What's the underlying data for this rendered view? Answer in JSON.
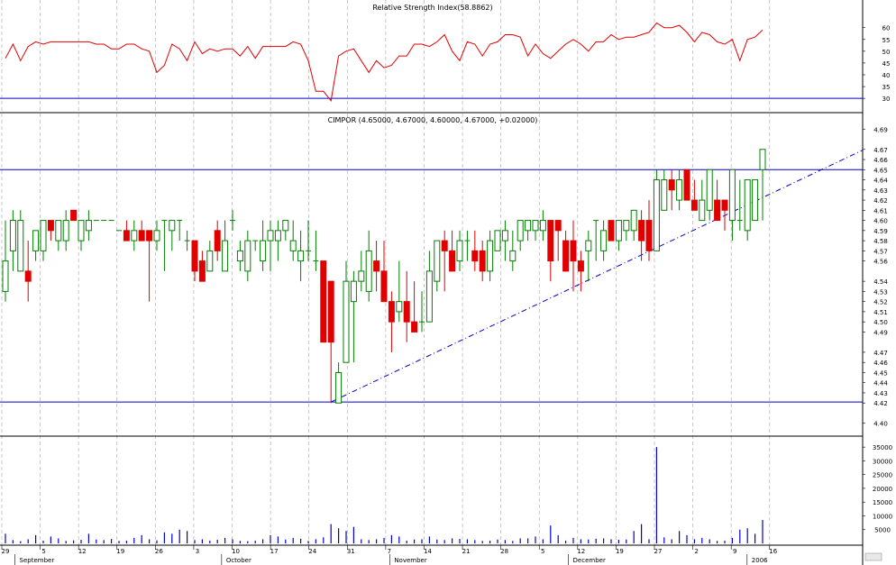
{
  "chart_data": [
    {
      "type": "line",
      "title": "Relative Strength Index(58.8862)",
      "ylim": [
        27,
        66
      ],
      "yticks": [
        30,
        35,
        40,
        45,
        50,
        55,
        60
      ],
      "reference_level": 30,
      "series": [
        {
          "name": "RSI",
          "color": "#e00000",
          "values": [
            47,
            53,
            46,
            52,
            54,
            53,
            54,
            54,
            54,
            54,
            54,
            54,
            53,
            53,
            51,
            51,
            53,
            53,
            51,
            50,
            41,
            44,
            53,
            51,
            46,
            54,
            49,
            51,
            50,
            51,
            51,
            48,
            52,
            47,
            52,
            52,
            52,
            52,
            54,
            53,
            46,
            33,
            33,
            29,
            48,
            50,
            51,
            46,
            41,
            46,
            43,
            44,
            48,
            48,
            53,
            53,
            52,
            54,
            57,
            50,
            46,
            54,
            53,
            48,
            53,
            54,
            57,
            57,
            56,
            48,
            53,
            49,
            47,
            50,
            53,
            55,
            53,
            50,
            54,
            54,
            57,
            55,
            56,
            56,
            57,
            58,
            62,
            60,
            60,
            61,
            58,
            54,
            58,
            57,
            54,
            53,
            55,
            46,
            55,
            56,
            59
          ]
        }
      ]
    },
    {
      "type": "candlestick",
      "title": "CIMPOR (4.65000, 4.67000, 4.60000, 4.67000, +0.02000)",
      "ylim": [
        4.39,
        4.7
      ],
      "yticks": [
        "4.40",
        "4.42",
        "4.43",
        "4.44",
        "4.45",
        "4.46",
        "4.47",
        "4.49",
        "4.50",
        "4.51",
        "4.52",
        "4.53",
        "4.54",
        "4.56",
        "4.57",
        "4.58",
        "4.59",
        "4.60",
        "4.61",
        "4.62",
        "4.63",
        "4.64",
        "4.65",
        "4.66",
        "4.67",
        "4.69"
      ],
      "horizontal_levels": [
        4.65,
        4.421
      ],
      "trendline": {
        "from": [
          43,
          4.421
        ],
        "to": [
          114,
          4.672
        ],
        "style": "dash-dot",
        "color": "#0000c8"
      },
      "colors": {
        "up": "#008000",
        "down": "#e00000",
        "doji": "#008000"
      },
      "candles": [
        {
          "o": 4.53,
          "h": 4.6,
          "l": 4.52,
          "c": 4.56
        },
        {
          "o": 4.57,
          "h": 4.61,
          "l": 4.55,
          "c": 4.6
        },
        {
          "o": 4.55,
          "h": 4.61,
          "l": 4.55,
          "c": 4.6
        },
        {
          "o": 4.55,
          "h": 4.58,
          "l": 4.52,
          "c": 4.54
        },
        {
          "o": 4.57,
          "h": 4.59,
          "l": 4.56,
          "c": 4.59
        },
        {
          "o": 4.57,
          "h": 4.6,
          "l": 4.56,
          "c": 4.6
        },
        {
          "o": 4.6,
          "h": 4.6,
          "l": 4.58,
          "c": 4.59
        },
        {
          "o": 4.58,
          "h": 4.6,
          "l": 4.57,
          "c": 4.6
        },
        {
          "o": 4.58,
          "h": 4.61,
          "l": 4.57,
          "c": 4.6
        },
        {
          "o": 4.61,
          "h": 4.61,
          "l": 4.6,
          "c": 4.6
        },
        {
          "o": 4.58,
          "h": 4.6,
          "l": 4.57,
          "c": 4.6
        },
        {
          "o": 4.59,
          "h": 4.61,
          "l": 4.58,
          "c": 4.6
        },
        {
          "o": 4.6,
          "h": 4.6,
          "l": 4.6,
          "c": 4.6
        },
        {
          "o": 4.6,
          "h": 4.6,
          "l": 4.6,
          "c": 4.6
        },
        {
          "o": 4.6,
          "h": 4.6,
          "l": 4.6,
          "c": 4.6
        },
        {
          "o": 4.59,
          "h": 4.59,
          "l": 4.59,
          "c": 4.59
        },
        {
          "o": 4.59,
          "h": 4.6,
          "l": 4.58,
          "c": 4.58
        },
        {
          "o": 4.58,
          "h": 4.6,
          "l": 4.57,
          "c": 4.59
        },
        {
          "o": 4.59,
          "h": 4.6,
          "l": 4.58,
          "c": 4.58
        },
        {
          "o": 4.59,
          "h": 4.59,
          "l": 4.52,
          "c": 4.58
        },
        {
          "o": 4.58,
          "h": 4.6,
          "l": 4.57,
          "c": 4.59
        },
        {
          "o": 4.6,
          "h": 4.6,
          "l": 4.55,
          "c": 4.6
        },
        {
          "o": 4.59,
          "h": 4.6,
          "l": 4.57,
          "c": 4.6
        },
        {
          "o": 4.6,
          "h": 4.6,
          "l": 4.58,
          "c": 4.6
        },
        {
          "o": 4.58,
          "h": 4.59,
          "l": 4.57,
          "c": 4.58
        },
        {
          "o": 4.58,
          "h": 4.58,
          "l": 4.54,
          "c": 4.55
        },
        {
          "o": 4.56,
          "h": 4.57,
          "l": 4.54,
          "c": 4.54
        },
        {
          "o": 4.55,
          "h": 4.58,
          "l": 4.55,
          "c": 4.57
        },
        {
          "o": 4.59,
          "h": 4.6,
          "l": 4.56,
          "c": 4.57
        },
        {
          "o": 4.55,
          "h": 4.6,
          "l": 4.55,
          "c": 4.58
        },
        {
          "o": 4.6,
          "h": 4.61,
          "l": 4.59,
          "c": 4.6
        },
        {
          "o": 4.56,
          "h": 4.58,
          "l": 4.55,
          "c": 4.57
        },
        {
          "o": 4.55,
          "h": 4.59,
          "l": 4.54,
          "c": 4.58
        },
        {
          "o": 4.58,
          "h": 4.58,
          "l": 4.57,
          "c": 4.58
        },
        {
          "o": 4.56,
          "h": 4.6,
          "l": 4.55,
          "c": 4.58
        },
        {
          "o": 4.58,
          "h": 4.6,
          "l": 4.55,
          "c": 4.59
        },
        {
          "o": 4.58,
          "h": 4.6,
          "l": 4.56,
          "c": 4.59
        },
        {
          "o": 4.59,
          "h": 4.6,
          "l": 4.58,
          "c": 4.6
        },
        {
          "o": 4.57,
          "h": 4.6,
          "l": 4.56,
          "c": 4.58
        },
        {
          "o": 4.56,
          "h": 4.59,
          "l": 4.54,
          "c": 4.57
        },
        {
          "o": 4.57,
          "h": 4.6,
          "l": 4.56,
          "c": 4.57
        },
        {
          "o": 4.56,
          "h": 4.59,
          "l": 4.55,
          "c": 4.56
        },
        {
          "o": 4.56,
          "h": 4.56,
          "l": 4.48,
          "c": 4.48
        },
        {
          "o": 4.54,
          "h": 4.54,
          "l": 4.42,
          "c": 4.48
        },
        {
          "o": 4.42,
          "h": 4.46,
          "l": 4.42,
          "c": 4.45
        },
        {
          "o": 4.46,
          "h": 4.56,
          "l": 4.46,
          "c": 4.54
        },
        {
          "o": 4.52,
          "h": 4.55,
          "l": 4.46,
          "c": 4.54
        },
        {
          "o": 4.54,
          "h": 4.57,
          "l": 4.53,
          "c": 4.55
        },
        {
          "o": 4.53,
          "h": 4.59,
          "l": 4.52,
          "c": 4.57
        },
        {
          "o": 4.56,
          "h": 4.58,
          "l": 4.53,
          "c": 4.55
        },
        {
          "o": 4.55,
          "h": 4.58,
          "l": 4.52,
          "c": 4.52
        },
        {
          "o": 4.52,
          "h": 4.53,
          "l": 4.47,
          "c": 4.5
        },
        {
          "o": 4.51,
          "h": 4.56,
          "l": 4.5,
          "c": 4.52
        },
        {
          "o": 4.52,
          "h": 4.55,
          "l": 4.48,
          "c": 4.5
        },
        {
          "o": 4.5,
          "h": 4.54,
          "l": 4.49,
          "c": 4.49
        },
        {
          "o": 4.5,
          "h": 4.53,
          "l": 4.49,
          "c": 4.5
        },
        {
          "o": 4.5,
          "h": 4.57,
          "l": 4.5,
          "c": 4.55
        },
        {
          "o": 4.54,
          "h": 4.58,
          "l": 4.53,
          "c": 4.58
        },
        {
          "o": 4.58,
          "h": 4.59,
          "l": 4.53,
          "c": 4.57
        },
        {
          "o": 4.57,
          "h": 4.59,
          "l": 4.55,
          "c": 4.55
        },
        {
          "o": 4.56,
          "h": 4.59,
          "l": 4.55,
          "c": 4.58
        },
        {
          "o": 4.58,
          "h": 4.59,
          "l": 4.56,
          "c": 4.58
        },
        {
          "o": 4.57,
          "h": 4.59,
          "l": 4.55,
          "c": 4.56
        },
        {
          "o": 4.57,
          "h": 4.58,
          "l": 4.54,
          "c": 4.55
        },
        {
          "o": 4.55,
          "h": 4.59,
          "l": 4.54,
          "c": 4.58
        },
        {
          "o": 4.57,
          "h": 4.59,
          "l": 4.57,
          "c": 4.59
        },
        {
          "o": 4.58,
          "h": 4.6,
          "l": 4.56,
          "c": 4.59
        },
        {
          "o": 4.56,
          "h": 4.59,
          "l": 4.55,
          "c": 4.57
        },
        {
          "o": 4.58,
          "h": 4.6,
          "l": 4.57,
          "c": 4.6
        },
        {
          "o": 4.59,
          "h": 4.6,
          "l": 4.58,
          "c": 4.6
        },
        {
          "o": 4.59,
          "h": 4.6,
          "l": 4.58,
          "c": 4.6
        },
        {
          "o": 4.59,
          "h": 4.61,
          "l": 4.58,
          "c": 4.6
        },
        {
          "o": 4.6,
          "h": 4.6,
          "l": 4.54,
          "c": 4.56
        },
        {
          "o": 4.6,
          "h": 4.6,
          "l": 4.56,
          "c": 4.59
        },
        {
          "o": 4.58,
          "h": 4.59,
          "l": 4.55,
          "c": 4.55
        },
        {
          "o": 4.58,
          "h": 4.6,
          "l": 4.53,
          "c": 4.56
        },
        {
          "o": 4.56,
          "h": 4.57,
          "l": 4.53,
          "c": 4.55
        },
        {
          "o": 4.57,
          "h": 4.59,
          "l": 4.54,
          "c": 4.58
        },
        {
          "o": 4.6,
          "h": 4.6,
          "l": 4.56,
          "c": 4.6
        },
        {
          "o": 4.57,
          "h": 4.6,
          "l": 4.56,
          "c": 4.59
        },
        {
          "o": 4.6,
          "h": 4.6,
          "l": 4.58,
          "c": 4.58
        },
        {
          "o": 4.58,
          "h": 4.6,
          "l": 4.57,
          "c": 4.6
        },
        {
          "o": 4.59,
          "h": 4.6,
          "l": 4.58,
          "c": 4.6
        },
        {
          "o": 4.59,
          "h": 4.61,
          "l": 4.58,
          "c": 4.61
        },
        {
          "o": 4.6,
          "h": 4.61,
          "l": 4.56,
          "c": 4.58
        },
        {
          "o": 4.6,
          "h": 4.62,
          "l": 4.56,
          "c": 4.57
        },
        {
          "o": 4.57,
          "h": 4.65,
          "l": 4.57,
          "c": 4.64
        },
        {
          "o": 4.61,
          "h": 4.65,
          "l": 4.61,
          "c": 4.64
        },
        {
          "o": 4.64,
          "h": 4.65,
          "l": 4.61,
          "c": 4.63
        },
        {
          "o": 4.62,
          "h": 4.65,
          "l": 4.61,
          "c": 4.64
        },
        {
          "o": 4.65,
          "h": 4.65,
          "l": 4.62,
          "c": 4.62
        },
        {
          "o": 4.62,
          "h": 4.64,
          "l": 4.61,
          "c": 4.61
        },
        {
          "o": 4.6,
          "h": 4.64,
          "l": 4.6,
          "c": 4.62
        },
        {
          "o": 4.61,
          "h": 4.65,
          "l": 4.6,
          "c": 4.65
        },
        {
          "o": 4.62,
          "h": 4.64,
          "l": 4.6,
          "c": 4.6
        },
        {
          "o": 4.62,
          "h": 4.62,
          "l": 4.59,
          "c": 4.61
        },
        {
          "o": 4.6,
          "h": 4.65,
          "l": 4.58,
          "c": 4.65
        },
        {
          "o": 4.6,
          "h": 4.64,
          "l": 4.59,
          "c": 4.6
        },
        {
          "o": 4.59,
          "h": 4.64,
          "l": 4.58,
          "c": 4.64
        },
        {
          "o": 4.6,
          "h": 4.64,
          "l": 4.6,
          "c": 4.64
        },
        {
          "o": 4.65,
          "h": 4.67,
          "l": 4.6,
          "c": 4.67
        }
      ]
    },
    {
      "type": "bar",
      "title": "",
      "ylim": [
        0,
        38000
      ],
      "yticks": [
        5000,
        10000,
        15000,
        20000,
        25000,
        30000,
        35000
      ],
      "color": "#0000c8",
      "values": [
        3500,
        1200,
        800,
        1500,
        3000,
        1000,
        2500,
        1800,
        900,
        1100,
        1300,
        3500,
        1400,
        1200,
        1600,
        900,
        1000,
        2000,
        3000,
        1500,
        1100,
        4000,
        3500,
        5000,
        4500,
        1200,
        1500,
        1000,
        1300,
        2000,
        1500,
        900,
        800,
        1000,
        1500,
        3000,
        2500,
        1400,
        2000,
        1700,
        900,
        1500,
        2200,
        7000,
        5500,
        4500,
        6000,
        1500,
        1200,
        1500,
        2000,
        3000,
        2500,
        1000,
        1400,
        1500,
        2500,
        1400,
        1200,
        1800,
        1600,
        1500,
        1200,
        900,
        1000,
        1400,
        1200,
        900,
        1800,
        1800,
        2500,
        1500,
        6500,
        3000,
        1000,
        2000,
        1500,
        1400,
        1700,
        1800,
        1500,
        1300,
        1400,
        4500,
        7000,
        1500,
        35000,
        2200,
        1500,
        4500,
        3000,
        1500,
        2000,
        1500,
        900,
        1000,
        2000,
        5000,
        5500,
        3500,
        8500
      ]
    }
  ],
  "x_axis": {
    "day_ticks": [
      "29",
      "5",
      "12",
      "19",
      "26",
      "3",
      "10",
      "17",
      "24",
      "31",
      "7",
      "14",
      "21",
      "28",
      "5",
      "12",
      "19",
      "27",
      "2",
      "9",
      "16"
    ],
    "month_labels": [
      "September",
      "October",
      "November",
      "December",
      "2006"
    ]
  }
}
